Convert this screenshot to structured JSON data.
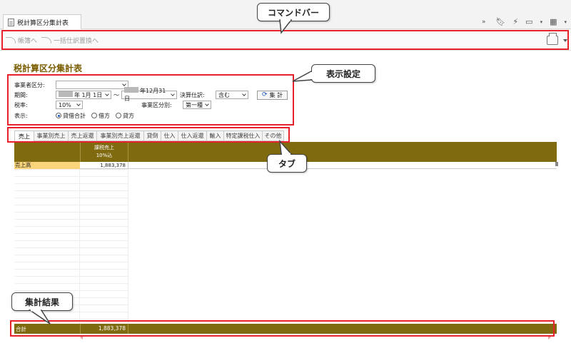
{
  "window": {
    "doc_tab_label": "税計算区分集計表",
    "overflow_glyph": "»"
  },
  "command_bar": {
    "buttons": [
      {
        "label": "帳簿へ"
      },
      {
        "label": "一括仕訳置換へ"
      }
    ]
  },
  "page": {
    "title": "税計算区分集計表"
  },
  "settings": {
    "business_type_label": "事業者区分:",
    "business_type_value": "",
    "period_label": "期間:",
    "period_from": "年 1月 1日",
    "period_tilde": "～",
    "period_to": "年12月31日",
    "closing_label": "決算仕訳:",
    "closing_value": "含む",
    "aggregate_button": "集 計",
    "tax_rate_label": "税率:",
    "tax_rate_value": "10%",
    "business_category_label": "事業区分別:",
    "business_category_value": "第一種",
    "display_label": "表示:",
    "display_options": [
      {
        "label": "貸借合計",
        "selected": true
      },
      {
        "label": "借方",
        "selected": false
      },
      {
        "label": "貸方",
        "selected": false
      }
    ]
  },
  "tabs": [
    {
      "label": "売上",
      "active": true
    },
    {
      "label": "事業別売上",
      "active": false
    },
    {
      "label": "売上返還",
      "active": false
    },
    {
      "label": "事業別売上返還",
      "active": false
    },
    {
      "label": "貸倒",
      "active": false
    },
    {
      "label": "仕入",
      "active": false
    },
    {
      "label": "仕入返還",
      "active": false
    },
    {
      "label": "輸入",
      "active": false
    },
    {
      "label": "特定課税仕入",
      "active": false
    },
    {
      "label": "その他",
      "active": false
    }
  ],
  "grid": {
    "col_header_line1": "課税売上",
    "col_header_line2": "10%込",
    "rows": [
      {
        "label": "売上高",
        "value": "1,883,378"
      }
    ]
  },
  "footer": {
    "label": "合計",
    "value": "1,883,378"
  },
  "annotations": {
    "command_bar": "コマンドバー",
    "display_settings": "表示設定",
    "tab": "タブ",
    "result": "集計結果"
  },
  "colors": {
    "accent_olive": "#7f6a10",
    "highlight_red": "#e8202a",
    "row_label_bg": "#f9d47a",
    "title_brown": "#7a5c00"
  }
}
